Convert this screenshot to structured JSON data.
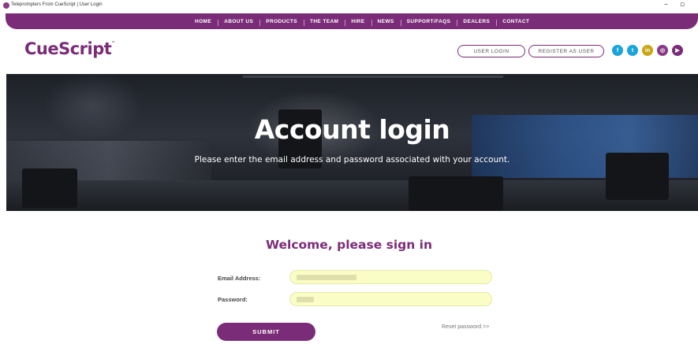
{
  "window": {
    "title": "Teleprompters From CueScript | User Login",
    "minimize_glyph": "–",
    "maximize_glyph": "▫"
  },
  "nav": {
    "items": [
      {
        "label": "HOME"
      },
      {
        "label": "ABOUT US"
      },
      {
        "label": "PRODUCTS"
      },
      {
        "label": "THE TEAM"
      },
      {
        "label": "HIRE"
      },
      {
        "label": "NEWS"
      },
      {
        "label": "SUPPORT/FAQS"
      },
      {
        "label": "DEALERS"
      },
      {
        "label": "CONTACT"
      }
    ],
    "background_color": "#7b2c78"
  },
  "header": {
    "logo_text": "CueScript",
    "logo_tm": "™",
    "user_login_label": "USER LOGIN",
    "register_label": "REGISTER AS USER",
    "social_icons": [
      {
        "name": "facebook-icon",
        "glyph": "f",
        "color": "#1aa3dc"
      },
      {
        "name": "twitter-icon",
        "glyph": "t",
        "color": "#1aa3dc"
      },
      {
        "name": "linkedin-icon",
        "glyph": "in",
        "color": "#c9a714"
      },
      {
        "name": "instagram-icon",
        "glyph": "◎",
        "color": "#8a3a86"
      },
      {
        "name": "youtube-icon",
        "glyph": "▶",
        "color": "#7b2c78"
      }
    ]
  },
  "hero": {
    "heading": "Account login",
    "subtext": "Please enter the email address and password associated with your account."
  },
  "form": {
    "welcome": "Welcome, please sign in",
    "email_label": "Email Address:",
    "password_label": "Password:",
    "submit_label": "SUBMIT",
    "reset_link": "Reset password >>",
    "field_color": "#fbfdc6"
  }
}
